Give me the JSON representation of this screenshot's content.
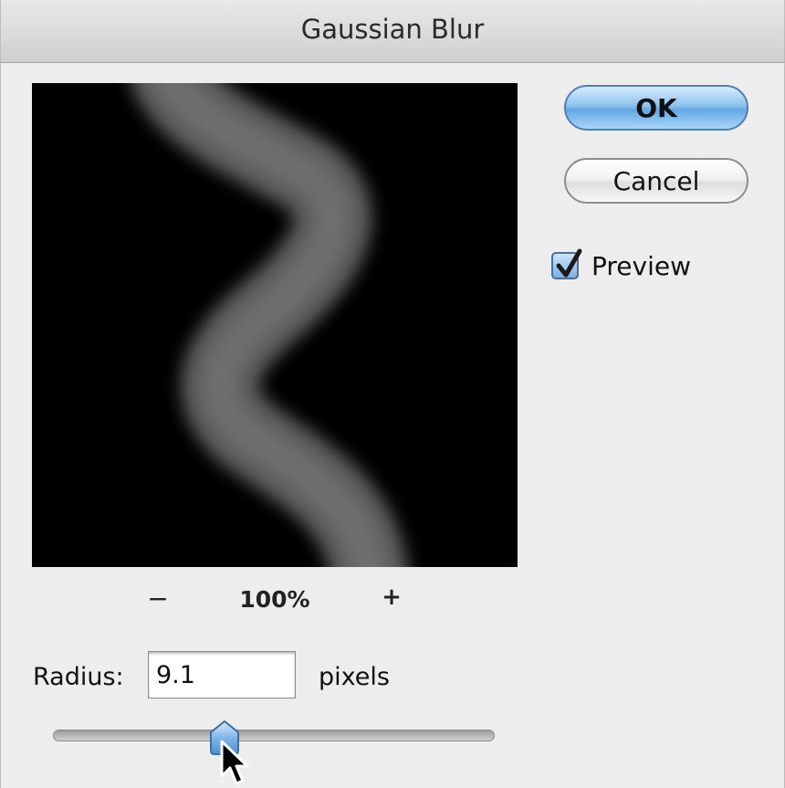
{
  "dialog": {
    "title": "Gaussian Blur"
  },
  "buttons": {
    "ok_label": "OK",
    "cancel_label": "Cancel"
  },
  "preview": {
    "label": "Preview",
    "checked": true
  },
  "zoom": {
    "minus": "−",
    "level": "100%",
    "plus": "+"
  },
  "radius": {
    "label": "Radius:",
    "value": "9.1",
    "units": "pixels",
    "slider_fraction": 0.39
  },
  "colors": {
    "ok_button": "#8ec3ee",
    "preview_background": "#000000",
    "checkbox_accent": "#7bb0e4"
  },
  "icons": {
    "checkbox": "checkmark-icon",
    "cursor": "mouse-pointer-icon",
    "slider_thumb": "slider-thumb-icon"
  }
}
